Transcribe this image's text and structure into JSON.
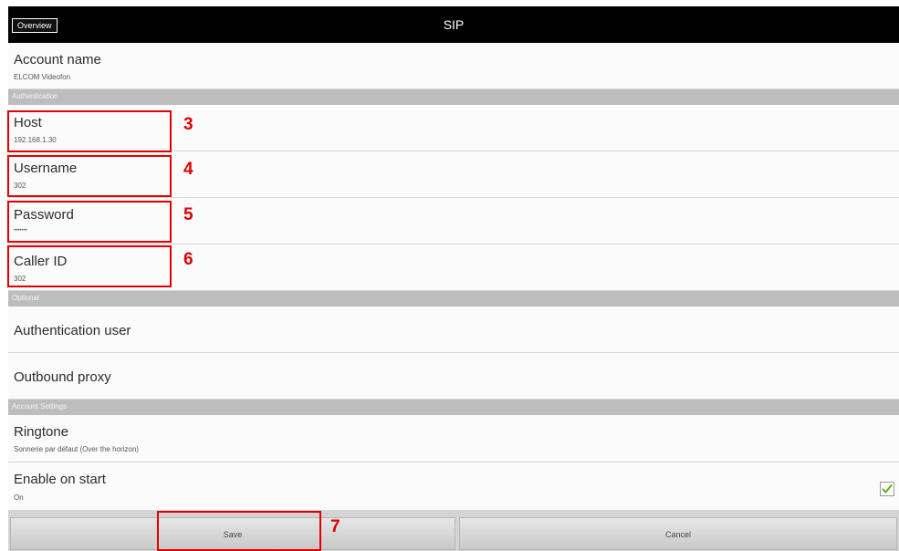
{
  "titlebar": {
    "overview_label": "Overview",
    "title": "SIP"
  },
  "account_name": {
    "label": "Account name",
    "value": "ELCOM Videofon"
  },
  "sections": {
    "authentication": "Authentication",
    "optional": "Optional",
    "account_settings": "Account Settings"
  },
  "host": {
    "label": "Host",
    "value": "192.168.1.30"
  },
  "username": {
    "label": "Username",
    "value": "302"
  },
  "password": {
    "label": "Password",
    "value": "•••••••"
  },
  "caller_id": {
    "label": "Caller ID",
    "value": "302"
  },
  "authentication_user": {
    "label": "Authentication user"
  },
  "outbound_proxy": {
    "label": "Outbound proxy"
  },
  "ringtone": {
    "label": "Ringtone",
    "value": "Sonnerie par défaut (Over the horizon)"
  },
  "enable_on_start": {
    "label": "Enable on start",
    "value": "On",
    "checked": true
  },
  "buttons": {
    "save": "Save",
    "cancel": "Cancel"
  },
  "callouts": [
    "3",
    "4",
    "5",
    "6",
    "7"
  ],
  "colors": {
    "callout": "#e00000",
    "check": "#5cb531",
    "section": "#bdbdbd",
    "titlebar": "#000000"
  }
}
